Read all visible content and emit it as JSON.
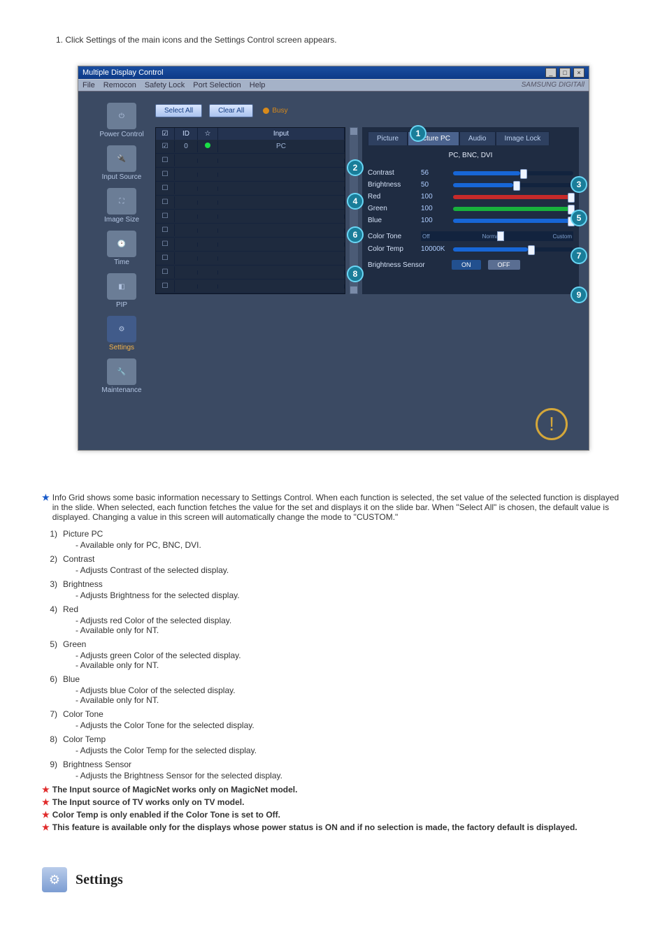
{
  "instruction": {
    "num": "1.",
    "text": "Click Settings of the main icons and the Settings Control screen appears."
  },
  "window": {
    "title": "Multiple Display Control",
    "menubar": [
      "File",
      "Remocon",
      "Safety Lock",
      "Port Selection",
      "Help"
    ],
    "brand": "SAMSUNG DIGITAll"
  },
  "sidebar": {
    "items": [
      {
        "label": "Power Control"
      },
      {
        "label": "Input Source"
      },
      {
        "label": "Image Size"
      },
      {
        "label": "Time"
      },
      {
        "label": "PIP"
      },
      {
        "label": "Settings"
      },
      {
        "label": "Maintenance"
      }
    ]
  },
  "toprow": {
    "selectAll": "Select All",
    "clearAll": "Clear All",
    "busy": "Busy"
  },
  "grid": {
    "headers": {
      "chk": "☑",
      "id": "ID",
      "st": "☆",
      "input": "Input"
    },
    "rows": [
      {
        "id": "0",
        "input": "PC",
        "led": true
      },
      {
        "id": "",
        "input": ""
      },
      {
        "id": "",
        "input": ""
      },
      {
        "id": "",
        "input": ""
      },
      {
        "id": "",
        "input": ""
      },
      {
        "id": "",
        "input": ""
      },
      {
        "id": "",
        "input": ""
      },
      {
        "id": "",
        "input": ""
      },
      {
        "id": "",
        "input": ""
      },
      {
        "id": "",
        "input": ""
      },
      {
        "id": "",
        "input": ""
      }
    ]
  },
  "panel": {
    "tabs": [
      "Picture",
      "Picture PC",
      "Audio",
      "Image Lock"
    ],
    "activeTab": 1,
    "subheader": "PC, BNC, DVI",
    "sliders": {
      "contrast": {
        "label": "Contrast",
        "value": "56",
        "pct": 56,
        "cls": "fill-blue"
      },
      "brightness": {
        "label": "Brightness",
        "value": "50",
        "pct": 50,
        "cls": "fill-blue"
      },
      "red": {
        "label": "Red",
        "value": "100",
        "pct": 100,
        "cls": "fill-red"
      },
      "green": {
        "label": "Green",
        "value": "100",
        "pct": 100,
        "cls": "fill-green"
      },
      "blue": {
        "label": "Blue",
        "value": "100",
        "pct": 100,
        "cls": "fill-blue"
      }
    },
    "colorTone": {
      "label": "Color Tone",
      "marks": [
        "Off",
        "Normal",
        "Custom"
      ]
    },
    "colorTemp": {
      "label": "Color Temp",
      "value": "10000K",
      "pct": 62
    },
    "sensor": {
      "label": "Brightness Sensor",
      "on": "ON",
      "off": "OFF"
    }
  },
  "notes": {
    "intro": "Info Grid shows some basic information necessary to Settings Control. When each function is selected, the set value of the selected function is displayed in the slide. When selected, each function fetches the value for the set and displays it on the slide bar. When \"Select All\" is chosen, the default value is displayed. Changing a value in this screen will automatically change the mode to \"CUSTOM.\"",
    "items": [
      {
        "n": "1)",
        "t": "Picture PC",
        "subs": [
          "Available only for PC, BNC, DVI."
        ]
      },
      {
        "n": "2)",
        "t": "Contrast",
        "subs": [
          "Adjusts Contrast of the selected display."
        ]
      },
      {
        "n": "3)",
        "t": "Brightness",
        "subs": [
          "Adjusts Brightness for the selected display."
        ]
      },
      {
        "n": "4)",
        "t": "Red",
        "subs": [
          "Adjusts red Color of the selected display.",
          "Available  only for NT."
        ]
      },
      {
        "n": "5)",
        "t": "Green",
        "subs": [
          "Adjusts green Color of the selected display.",
          "Available  only for NT."
        ]
      },
      {
        "n": "6)",
        "t": "Blue",
        "subs": [
          "Adjusts blue Color of the selected display.",
          "Available  only for NT."
        ]
      },
      {
        "n": "7)",
        "t": "Color Tone",
        "subs": [
          "Adjusts the Color Tone for the selected display."
        ]
      },
      {
        "n": "8)",
        "t": "Color Temp",
        "subs": [
          "Adjusts the Color Temp for the selected display."
        ]
      },
      {
        "n": "9)",
        "t": "Brightness Sensor",
        "subs": [
          "Adjusts the Brightness Sensor for the selected display."
        ]
      }
    ],
    "redNotes": [
      "The Input source of MagicNet works only on MagicNet model.",
      "The Input source of TV works only on TV model.",
      "Color Temp is only enabled if the Color Tone is set to Off.",
      "This feature is available only for the displays whose power status is ON and if no selection is made, the factory default is displayed."
    ]
  },
  "footer": {
    "heading": "Settings"
  }
}
